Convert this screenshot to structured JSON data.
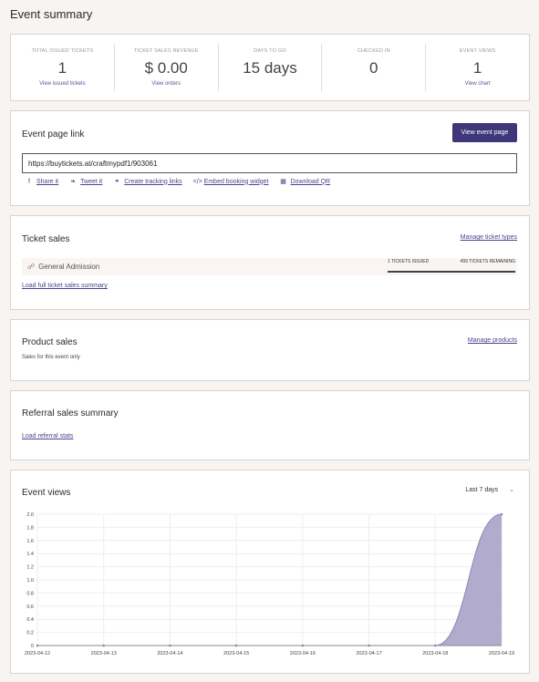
{
  "page": {
    "title": "Event summary"
  },
  "stats": [
    {
      "label": "TOTAL ISSUED TICKETS",
      "value": "1",
      "link": "View issued tickets"
    },
    {
      "label": "TICKET SALES REVENUE",
      "value": "$ 0.00",
      "link": "View orders"
    },
    {
      "label": "DAYS TO GO",
      "value": "15 days",
      "link": ""
    },
    {
      "label": "CHECKED IN",
      "value": "0",
      "link": ""
    },
    {
      "label": "EVENT VIEWS",
      "value": "1",
      "link": "View chart"
    }
  ],
  "event_link": {
    "title": "Event page link",
    "button": "View event page",
    "url": "https://buytickets.at/craftmypdf1/903061",
    "actions": [
      {
        "icon": "facebook-icon",
        "glyph": "f",
        "label": "Share it"
      },
      {
        "icon": "twitter-icon",
        "glyph": "❧",
        "label": "Tweet it"
      },
      {
        "icon": "link-icon",
        "glyph": "⚭",
        "label": "Create tracking links"
      },
      {
        "icon": "code-icon",
        "glyph": "</>",
        "label": "Embed booking widget"
      },
      {
        "icon": "qr-icon",
        "glyph": "▦",
        "label": "Download QR"
      }
    ]
  },
  "ticket_sales": {
    "title": "Ticket sales",
    "manage": "Manage ticket types",
    "row": {
      "label": "General Admission",
      "issued": "1 TICKETS ISSUED",
      "remaining": "499 TICKETS REMAINING",
      "fraction_sold": 0.002
    },
    "load": "Load full ticket sales summary"
  },
  "product_sales": {
    "title": "Product sales",
    "manage": "Manage products",
    "note": "Sales for this event only"
  },
  "referral": {
    "title": "Referral sales summary",
    "load": "Load referral stats"
  },
  "event_views": {
    "title": "Event views",
    "range": "Last 7 days"
  },
  "colors": {
    "accent": "#3f3779",
    "area": "#a9a3c9",
    "link": "#4a4490"
  },
  "chart_data": {
    "type": "area",
    "x": [
      "2023-04-12",
      "2023-04-13",
      "2023-04-14",
      "2023-04-15",
      "2023-04-16",
      "2023-04-17",
      "2023-04-18",
      "2023-04-19"
    ],
    "values": [
      0,
      0,
      0,
      0,
      0,
      0,
      0,
      2
    ],
    "yticks": [
      "0",
      "0.2",
      "0.4",
      "0.6",
      "0.8",
      "1.0",
      "1.2",
      "1.4",
      "1.6",
      "1.8",
      "2.0"
    ],
    "ylim": [
      0,
      2
    ],
    "grid": true
  }
}
